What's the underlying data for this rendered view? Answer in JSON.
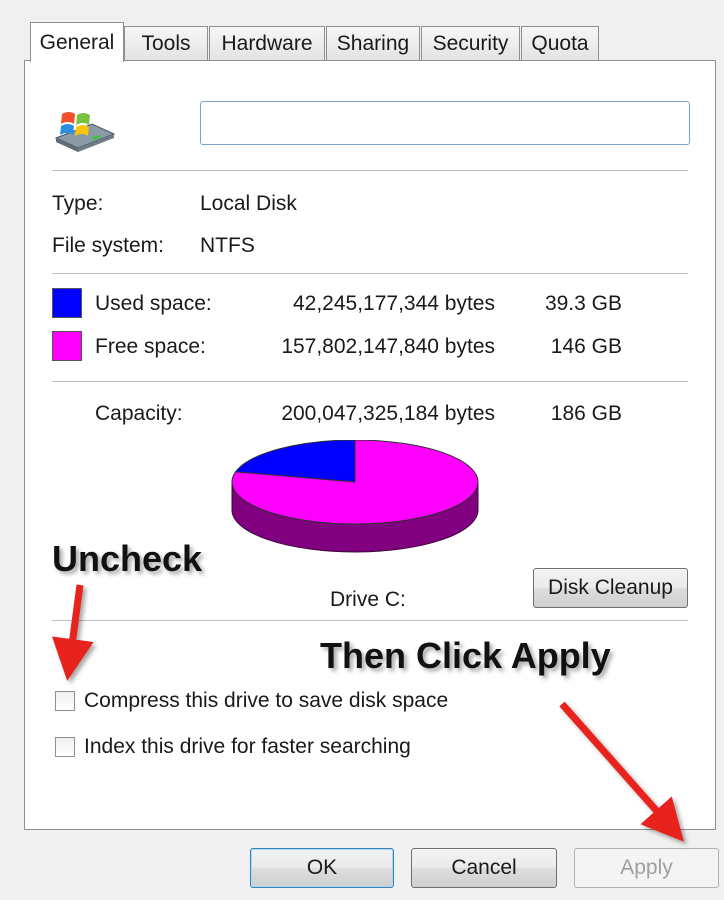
{
  "tabs": [
    {
      "label": "General",
      "active": true
    },
    {
      "label": "Tools"
    },
    {
      "label": "Hardware"
    },
    {
      "label": "Sharing"
    },
    {
      "label": "Security"
    },
    {
      "label": "Quota"
    }
  ],
  "drive_icon": "windows-drive-icon",
  "name_field": {
    "value": "",
    "placeholder": ""
  },
  "info": {
    "type_label": "Type:",
    "type_value": "Local Disk",
    "fs_label": "File system:",
    "fs_value": "NTFS"
  },
  "space": {
    "used": {
      "label": "Used space:",
      "bytes": "42,245,177,344 bytes",
      "size": "39.3 GB",
      "color": "#0000ff"
    },
    "free": {
      "label": "Free space:",
      "bytes": "157,802,147,840 bytes",
      "size": "146 GB",
      "color": "#ff00ff"
    },
    "capacity": {
      "label": "Capacity:",
      "bytes": "200,047,325,184 bytes",
      "size": "186 GB"
    }
  },
  "chart_data": {
    "type": "pie",
    "categories": [
      "Used space",
      "Free space"
    ],
    "values": [
      42245177344,
      157802147840
    ],
    "colors": [
      "#0000ff",
      "#ff00ff"
    ],
    "title": "Drive C:"
  },
  "disk_cleanup_label": "Disk Cleanup",
  "options": {
    "compress_label": "Compress this drive to save disk space",
    "compress_checked": false,
    "index_label": "Index this drive for faster searching",
    "index_checked": false
  },
  "annotations": {
    "uncheck": "Uncheck",
    "then_click_apply": "Then Click Apply",
    "arrow_color": "#e8221c"
  },
  "buttons": {
    "ok": "OK",
    "cancel": "Cancel",
    "apply": "Apply"
  }
}
